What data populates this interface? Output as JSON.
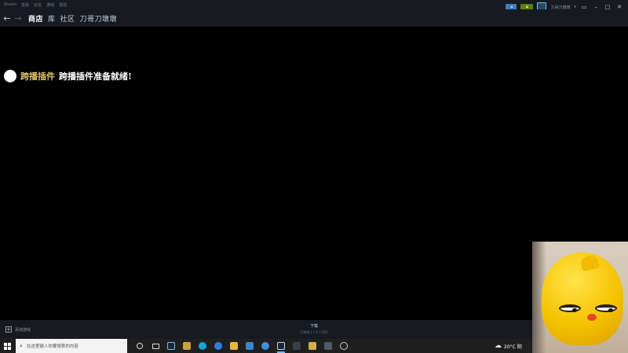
{
  "steam": {
    "menu": [
      "Steam",
      "查看",
      "好友",
      "游戏",
      "帮助"
    ],
    "titlebar": {
      "account": "刀哥刀墩墩"
    },
    "nav": {
      "back_glyph": "←",
      "forward_glyph": "→",
      "tabs": [
        "商店",
        "库",
        "社区",
        "刀哥刀墩墩"
      ],
      "active_tab": "商店"
    },
    "content": {
      "notice_brand": "跨播插件",
      "notice_message": "跨播插件准备就绪!"
    },
    "bottom": {
      "add_game": "添加游戏",
      "download_title": "下载",
      "download_status": "已完成 1 / 1 个项目"
    },
    "colors": {
      "chrome_bg": "#171a21",
      "accent_blue": "#3d7eb8",
      "accent_green": "#5c7e10",
      "notice_brand": "#e0c26a"
    }
  },
  "taskbar": {
    "search_placeholder": "在这里输入你要搜索的内容",
    "pinned_icons": [
      "task-view-icon",
      "multitask-icon",
      "steam-icon",
      "app-icon",
      "edge-icon",
      "browser-icon",
      "folder-icon",
      "mail-icon",
      "store-icon",
      "steam-icon",
      "app-icon",
      "app-icon",
      "app-icon",
      "app-icon"
    ],
    "weather_temp": "20°C 阴"
  },
  "webcam": {
    "subject": "yellow-duck-figurine"
  }
}
